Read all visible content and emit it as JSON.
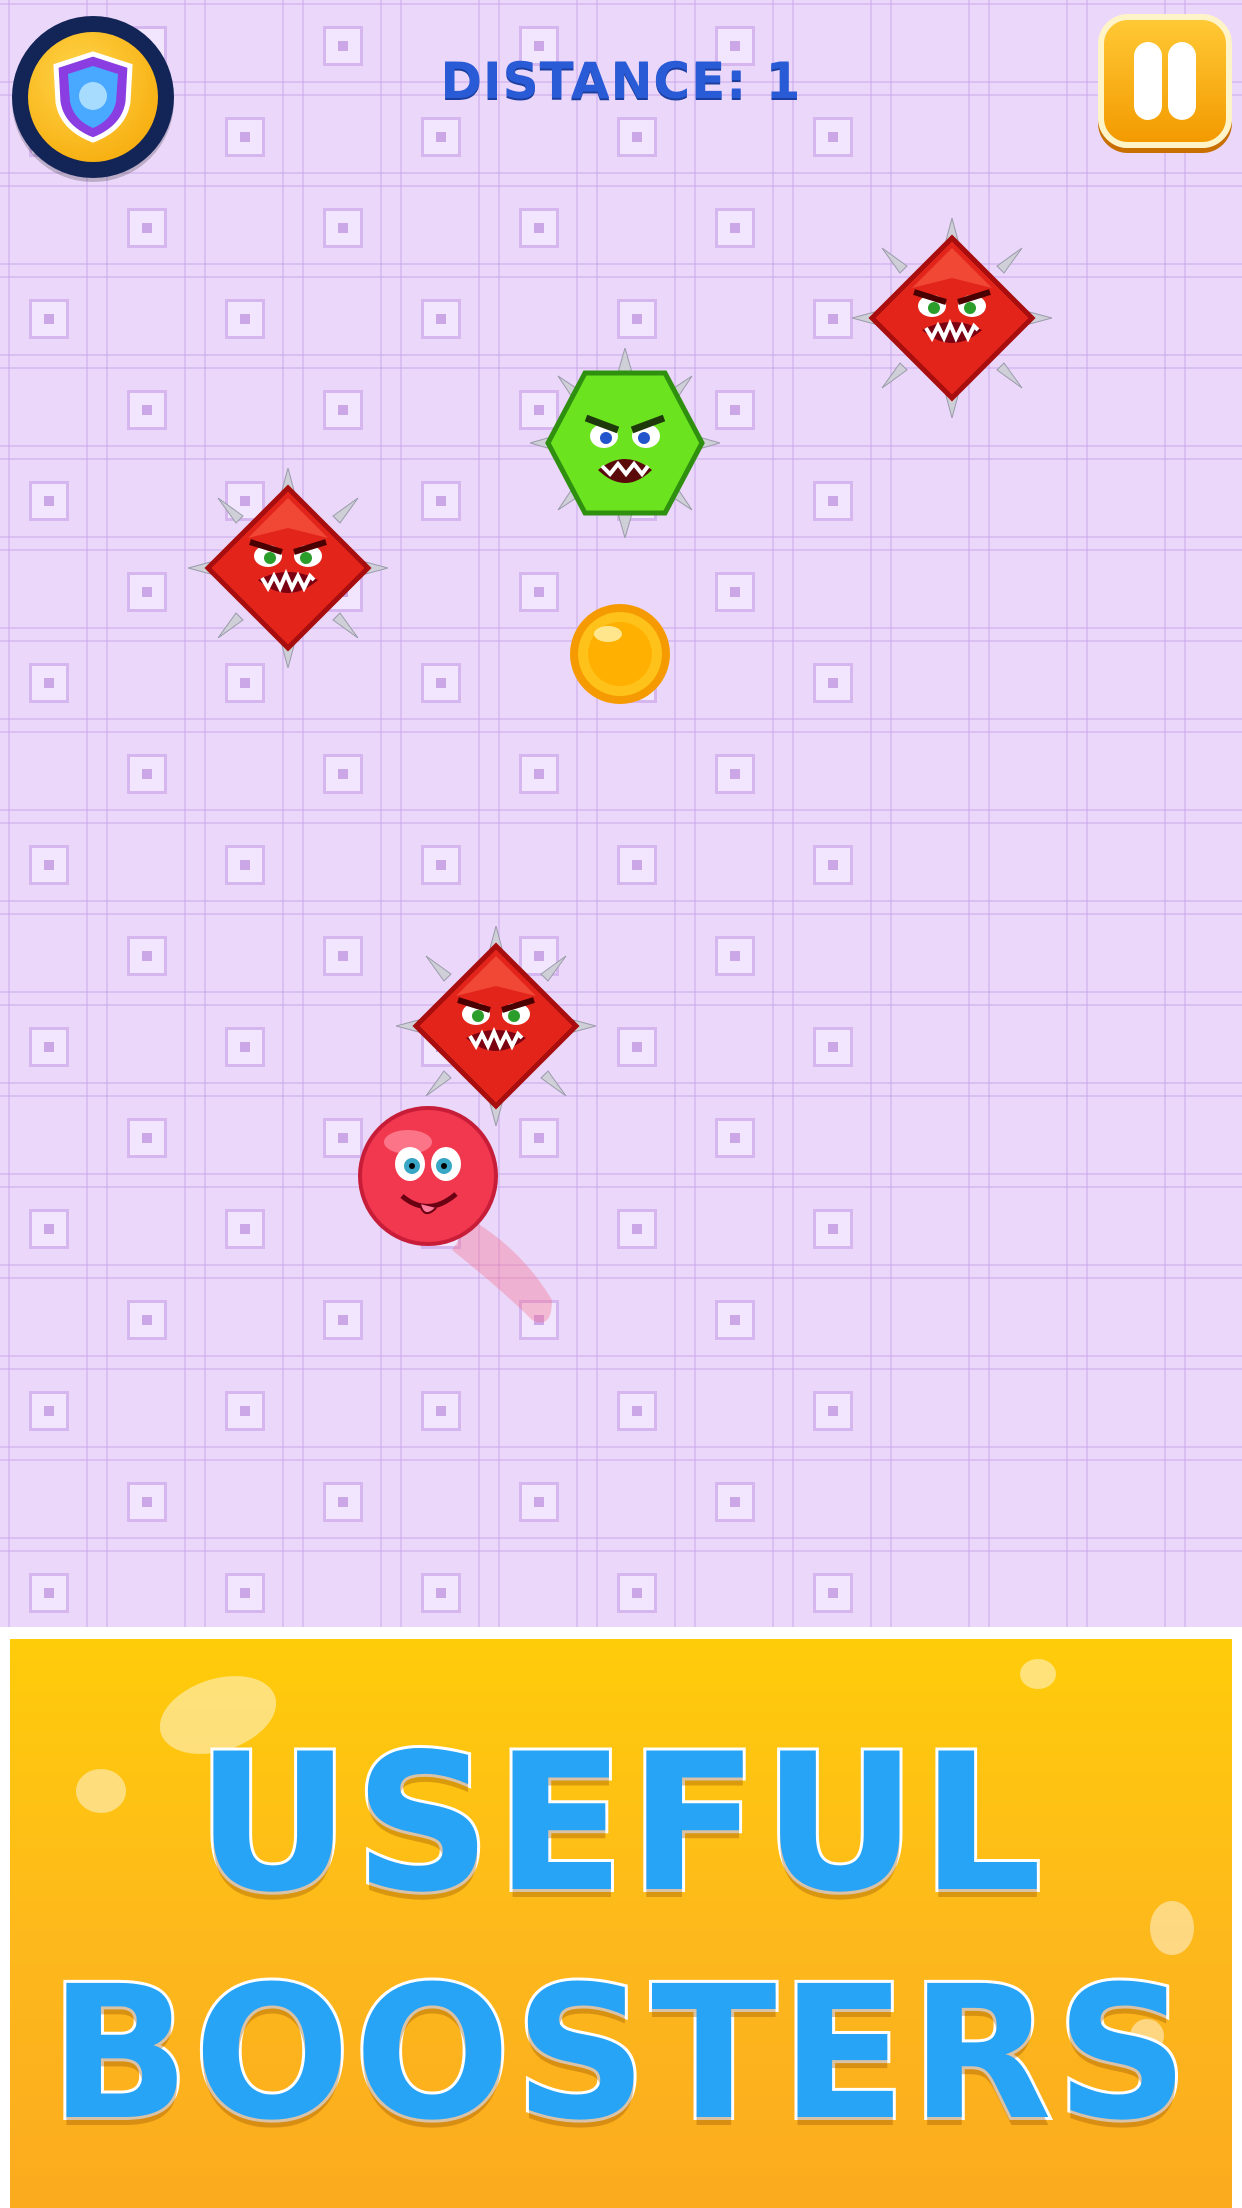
{
  "hud": {
    "distance_label": "DISTANCE: 1",
    "shield_icon": "shield-icon",
    "pause_icon": "pause-icon"
  },
  "game": {
    "player": {
      "type": "red-ball",
      "color": "#f2384f"
    },
    "enemies": [
      {
        "type": "spiked-red-diamond",
        "color": "#e3241b"
      },
      {
        "type": "spiked-green-hexagon",
        "color": "#6be31f"
      },
      {
        "type": "spiked-red-diamond",
        "color": "#e3241b"
      },
      {
        "type": "spiked-red-diamond",
        "color": "#e3241b"
      }
    ],
    "pickups": [
      {
        "type": "gold-coin",
        "color": "#ffb300"
      }
    ]
  },
  "banner": {
    "line1": "USEFUL",
    "line2": "BOOSTERS",
    "background_color": "#fdb81c",
    "text_color": "#27a4f6"
  }
}
